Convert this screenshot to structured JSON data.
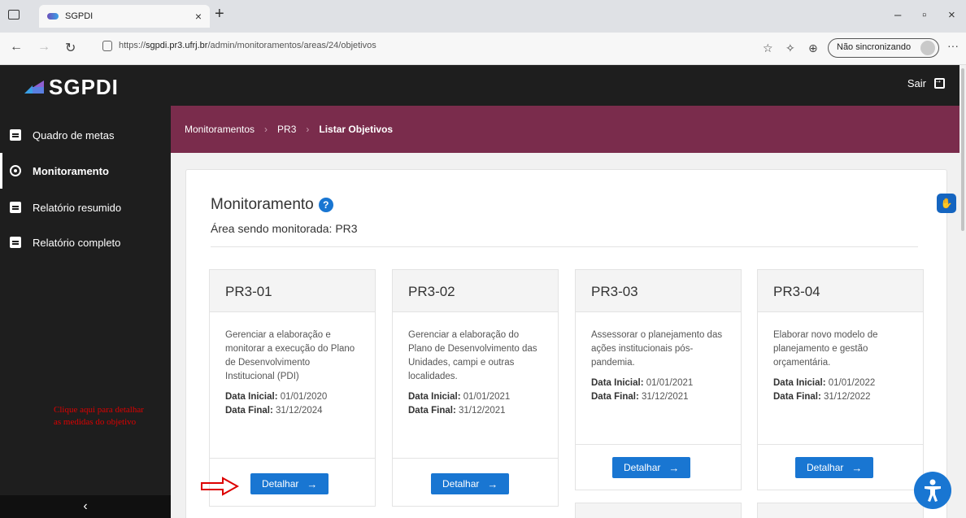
{
  "browser": {
    "tab_title": "SGPDI",
    "tab_close": "×",
    "new_tab": "+",
    "url_prefix": "https://",
    "url_host": "sgpdi.pr3.ufrj.br",
    "url_path": "/admin/monitoramentos/areas/24/objetivos",
    "sync_label": "Não sincronizando",
    "minimize": "–",
    "restore": "▫",
    "close": "×",
    "more": "···"
  },
  "app": {
    "logo_text": "SGPDI",
    "logout_label": "Sair"
  },
  "sidebar": {
    "items": [
      {
        "label": "Quadro de metas",
        "icon": "document-icon",
        "active": false
      },
      {
        "label": "Monitoramento",
        "icon": "eye-icon",
        "active": true
      },
      {
        "label": "Relatório resumido",
        "icon": "document-icon",
        "active": false
      },
      {
        "label": "Relatório completo",
        "icon": "document-icon",
        "active": false
      }
    ],
    "collapse": "‹",
    "annotation_line1": "Clique aqui para detalhar",
    "annotation_line2": "as medidas do objetivo"
  },
  "breadcrumb": [
    "Monitoramentos",
    "PR3",
    "Listar Objetivos"
  ],
  "breadcrumb_sep": "›",
  "panel": {
    "title": "Monitoramento",
    "help": "?",
    "subtitle": "Área sendo monitorada: PR3"
  },
  "labels": {
    "start": "Data Inicial:",
    "end": "Data Final:",
    "detail_button": "Detalhar",
    "arrow": "→"
  },
  "cards": [
    {
      "code": "PR3-01",
      "description": "Gerenciar a elaboração e monitorar a execução do Plano de Desenvolvimento Institucional (PDI)",
      "start": "01/01/2020",
      "end": "31/12/2024"
    },
    {
      "code": "PR3-02",
      "description": "Gerenciar a elaboração do Plano de Desenvolvimento das Unidades, campi e outras localidades.",
      "start": "01/01/2021",
      "end": "31/12/2021"
    },
    {
      "code": "PR3-03",
      "description": "Assessorar o planejamento das ações institucionais pós-pandemia.",
      "start": "01/01/2021",
      "end": "31/12/2021"
    },
    {
      "code": "PR3-04",
      "description": "Elaborar novo modelo de planejamento e gestão orçamentária.",
      "start": "01/01/2022",
      "end": "31/12/2022"
    }
  ],
  "colors": {
    "brand_maroon": "#7a2c4c",
    "primary_blue": "#1976d2",
    "sidebar_dark": "#1e1e1e",
    "annotation_red": "#dd0000"
  }
}
